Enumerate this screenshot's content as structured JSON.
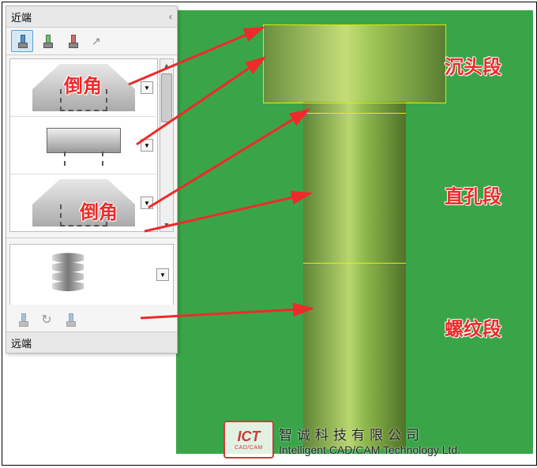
{
  "panel": {
    "header": "近端",
    "footer": "远端",
    "collapse_glyph": "‹",
    "segments": [
      {
        "type": "chamfer"
      },
      {
        "type": "cbore"
      },
      {
        "type": "chamfer"
      }
    ],
    "end_segment": {
      "type": "thread"
    }
  },
  "annotations": {
    "chamfer1": "倒角",
    "chamfer2": "倒角",
    "label_head": "沉头段",
    "label_body": "直孔段",
    "label_thread": "螺纹段"
  },
  "logo": {
    "short": "ICT",
    "sub": "CAD/CAM",
    "cn": "智诚科技有限公司",
    "en": "Intelligent CAD/CAM Technology Ltd."
  },
  "scroll": {
    "up": "▲",
    "down": "▼"
  },
  "dropdown_glyph": "▼"
}
